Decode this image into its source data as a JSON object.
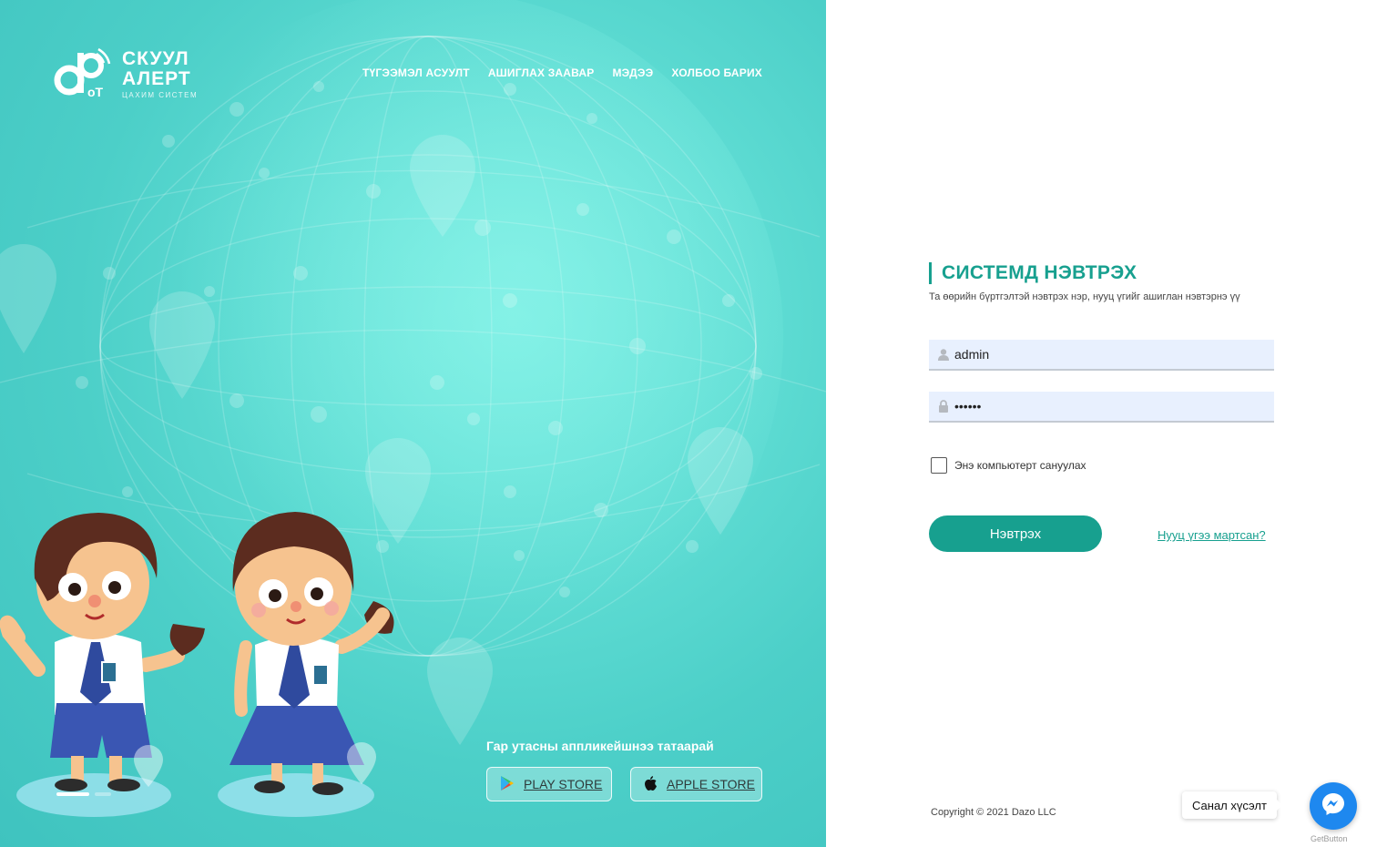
{
  "brand": {
    "line1": "СКУУЛ",
    "line2": "АЛЕРТ",
    "line3": "ЦАХИМ СИСТЕМ",
    "accent": "#17a08f"
  },
  "nav": {
    "items": [
      {
        "label": "ТҮГЭЭМЭЛ АСУУЛТ"
      },
      {
        "label": "АШИГЛАХ ЗААВАР"
      },
      {
        "label": "МЭДЭЭ"
      },
      {
        "label": "ХОЛБОО БАРИХ"
      }
    ]
  },
  "app_download": {
    "title": "Гар утасны аппликейшнээ татаарай",
    "play_label": "PLAY STORE",
    "play_icon": "google-play-icon",
    "apple_label": "APPLE STORE",
    "apple_icon": "apple-icon"
  },
  "login": {
    "title": "СИСТЕМД НЭВТРЭХ",
    "subtitle": "Та өөрийн бүртгэлтэй нэвтрэх нэр, нууц үгийг ашиглан нэвтэрнэ үү",
    "username_value": "admin",
    "username_icon": "user-icon",
    "password_value": "••••••",
    "password_icon": "lock-icon",
    "remember_label": "Энэ компьютерт сануулах",
    "remember_checked": false,
    "submit_label": "Нэвтрэх",
    "forgot_label": "Нууц үгээ мартсан?"
  },
  "footer": {
    "copyright": "Copyright © 2021 Dazo LLC"
  },
  "widget": {
    "feedback_label": "Санал хүсэлт",
    "button_icon": "messenger-icon",
    "powered_by": "GetButton"
  }
}
